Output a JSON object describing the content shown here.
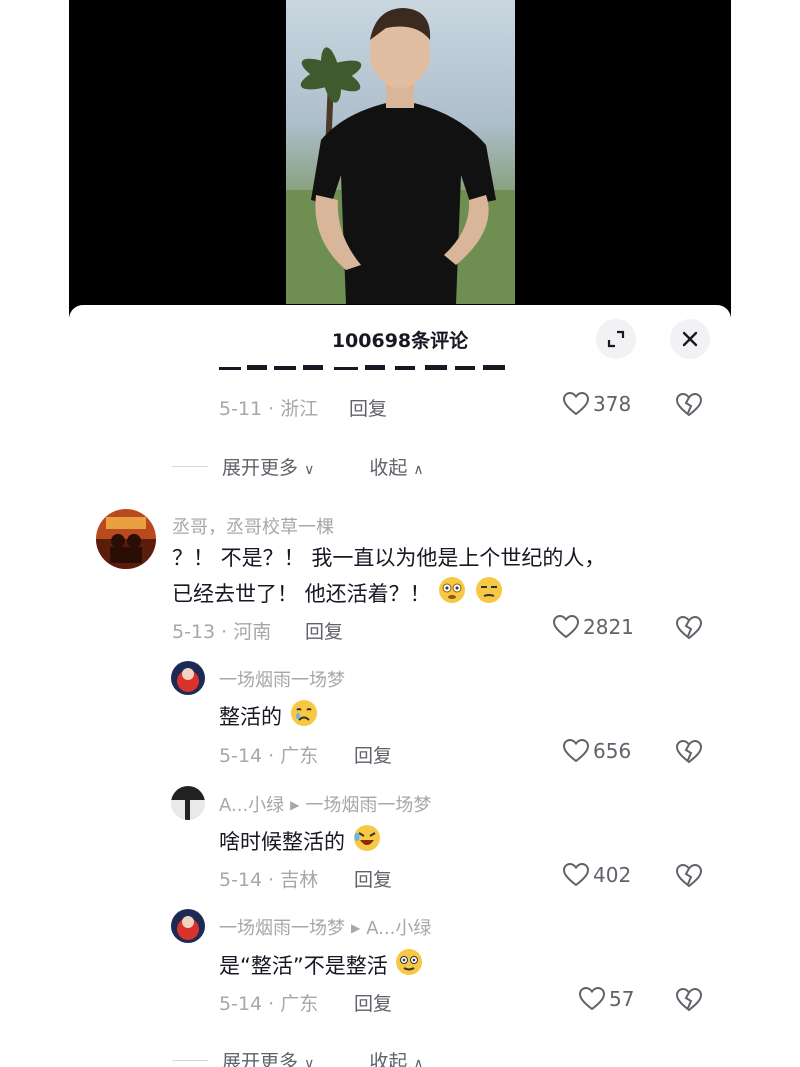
{
  "sheet": {
    "title": "100698条评论"
  },
  "comments": {
    "c0": {
      "date_loc": "5-11 · 浙江",
      "reply_label": "回复",
      "likes": "378"
    },
    "thread0": {
      "expand_label": "展开更多",
      "collapse_label": "收起"
    },
    "c1": {
      "author": "丞哥，丞哥校草一棵",
      "text_line1": "？！ 不是？！ 我一直以为他是上个世纪的人，",
      "text_line2": "已经去世了！ 他还活着？！",
      "date_loc": "5-13 · 河南",
      "reply_label": "回复",
      "likes": "2821"
    },
    "r1": {
      "author": "一场烟雨一场梦",
      "text": "整活的",
      "date_loc": "5-14 · 广东",
      "reply_label": "回复",
      "likes": "656"
    },
    "r2": {
      "author": "A...小绿",
      "reply_to": "一场烟雨一场梦",
      "text": "啥时候整活的",
      "date_loc": "5-14 · 吉林",
      "reply_label": "回复",
      "likes": "402"
    },
    "r3": {
      "author": "一场烟雨一场梦",
      "reply_to": "A...小绿",
      "text": "是“整活”不是整活",
      "date_loc": "5-14 · 广东",
      "reply_label": "回复",
      "likes": "57"
    },
    "thread1": {
      "expand_label": "展开更多",
      "collapse_label": "收起"
    }
  },
  "icons": {
    "search": "search-icon",
    "fullscreen": "fullscreen-icon",
    "close": "close-icon",
    "like": "heart-icon",
    "dislike": "broken-heart-icon"
  }
}
